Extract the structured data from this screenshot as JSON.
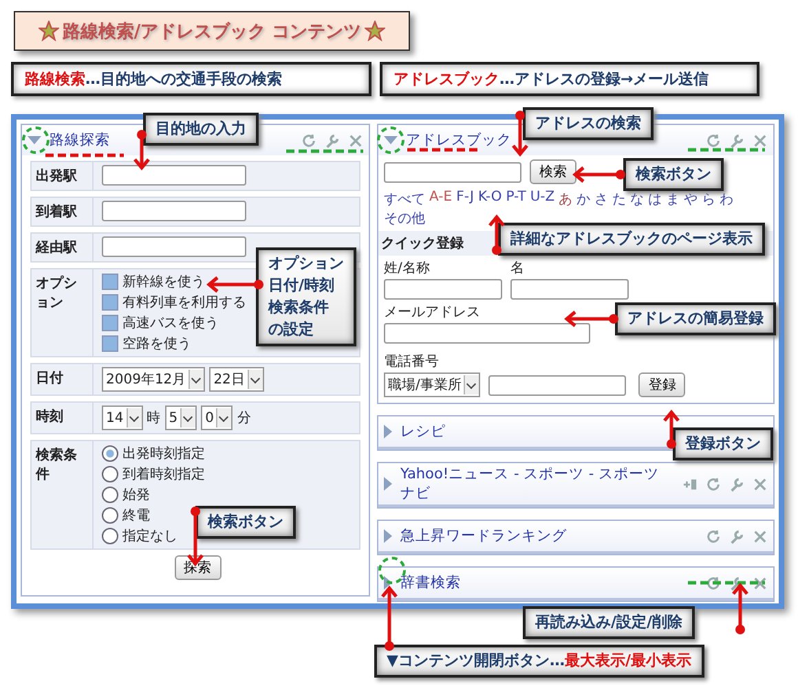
{
  "title": {
    "text": "路線検索/アドレスブック コンテンツ"
  },
  "sections": [
    {
      "highlight": "路線検索",
      "text": "…目的地への交通手段の検索"
    },
    {
      "highlight": "アドレスブック",
      "text": "…アドレスの登録→メール送信"
    }
  ],
  "route_widget": {
    "title": "路線探索",
    "expanded": true,
    "stations": [
      {
        "label": "出発駅"
      },
      {
        "label": "到着駅"
      },
      {
        "label": "経由駅"
      }
    ],
    "options": {
      "label": "オプション",
      "items": [
        {
          "label": "新幹線を使う",
          "checked": true
        },
        {
          "label": "有料列車を利用する",
          "checked": true
        },
        {
          "label": "高速バスを使う",
          "checked": true
        },
        {
          "label": "空路を使う",
          "checked": true
        }
      ]
    },
    "date": {
      "label": "日付",
      "year_month": "2009年12月",
      "day": "22日"
    },
    "time": {
      "label": "時刻",
      "hour": "14",
      "hour_unit": "時",
      "minute_tens": "5",
      "minute_units": "0",
      "minute_unit": "分"
    },
    "condition": {
      "label": "検索条件",
      "items": [
        {
          "label": "出発時刻指定",
          "selected": true
        },
        {
          "label": "到着時刻指定",
          "selected": false
        },
        {
          "label": "始発",
          "selected": false
        },
        {
          "label": "終電",
          "selected": false
        },
        {
          "label": "指定なし",
          "selected": false
        }
      ]
    },
    "button": "探索"
  },
  "address_widget": {
    "title": "アドレスブック",
    "expanded": true,
    "search_button": "検索",
    "index": [
      {
        "text": "すべて",
        "color": "#3a44b0"
      },
      {
        "text": "A-E",
        "color": "#c0504d"
      },
      {
        "text": "F-J",
        "color": "#3a44b0"
      },
      {
        "text": "K-O",
        "color": "#3a44b0"
      },
      {
        "text": "P-T",
        "color": "#3a44b0"
      },
      {
        "text": "U-Z",
        "color": "#3a44b0"
      },
      {
        "text": "あ",
        "color": "#a04848"
      },
      {
        "text": "か",
        "color": "#3a44b0"
      },
      {
        "text": "さ",
        "color": "#3a44b0"
      },
      {
        "text": "た",
        "color": "#3a44b0"
      },
      {
        "text": "な",
        "color": "#3a44b0"
      },
      {
        "text": "は",
        "color": "#3a44b0"
      },
      {
        "text": "ま",
        "color": "#3a44b0"
      },
      {
        "text": "や",
        "color": "#3a44b0"
      },
      {
        "text": "ら",
        "color": "#3a44b0"
      },
      {
        "text": "わ",
        "color": "#3a44b0"
      },
      {
        "text": "その他",
        "color": "#3a44b0"
      }
    ],
    "quick_title": "クイック登録",
    "last_name_label": "姓/名称",
    "first_name_label": "名",
    "email_label": "メールアドレス",
    "phone_label": "電話番号",
    "phone_type": "職場/事業所",
    "register_button": "登録"
  },
  "widgets": [
    {
      "title": "レシピ",
      "expanded": false,
      "kind": "plain"
    },
    {
      "title": "Yahoo!ニュース - スポーツ - スポーツナビ",
      "expanded": false,
      "kind": "extended"
    },
    {
      "title": "急上昇ワードランキング",
      "expanded": false,
      "kind": "standard"
    },
    {
      "title": "辞書検索",
      "expanded": false,
      "kind": "standard"
    }
  ],
  "callouts": [
    {
      "lines": [
        "目的地の入力"
      ]
    },
    {
      "lines": [
        "オプション",
        "日付/時刻",
        "検索条件",
        "の設定"
      ]
    },
    {
      "lines": [
        "検索ボタン"
      ]
    },
    {
      "lines": [
        "アドレスの検索"
      ]
    },
    {
      "lines": [
        "検索ボタン"
      ]
    },
    {
      "lines": [
        "詳細なアドレスブックのページ表示"
      ]
    },
    {
      "lines": [
        "アドレスの簡易登録"
      ]
    },
    {
      "lines": [
        "登録ボタン"
      ]
    },
    {
      "lines": [
        "再読み込み/設定/削除"
      ]
    },
    {
      "lines": [
        "▼コンテンツ開閉ボタン…"
      ],
      "highlight": "最大表示/最小表示"
    }
  ]
}
